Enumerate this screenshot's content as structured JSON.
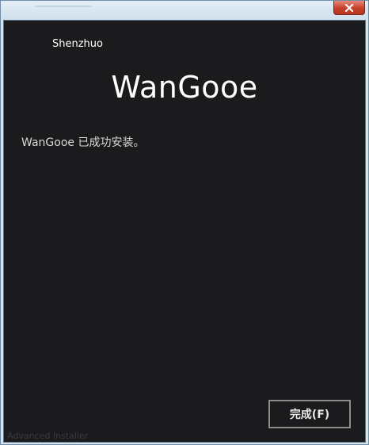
{
  "window": {
    "close_icon": "close-icon"
  },
  "header": {
    "company": "Shenzhuo",
    "product": "WanGooe"
  },
  "main": {
    "message": "WanGooe 已成功安装。"
  },
  "footer": {
    "watermark": "Advanced Installer",
    "finish_label": "完成(F)"
  },
  "colors": {
    "background": "#1b1a1d",
    "text": "#ffffff",
    "close_button": "#c6412a",
    "button_border": "#8d8d8d"
  }
}
